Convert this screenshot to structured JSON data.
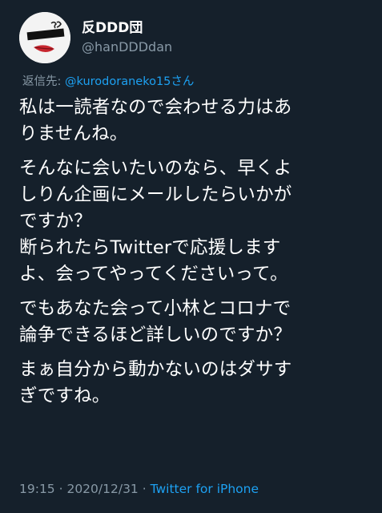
{
  "author": {
    "display_name": "反DDD団",
    "handle": "@hanDDDdan"
  },
  "reply": {
    "prefix": "返信先: ",
    "mention": "@kurodoraneko15さん"
  },
  "tweet": {
    "paragraphs": [
      [
        "私は一読者なので会わせる力はあ",
        "りませんね。"
      ],
      [
        "そんなに会いたいのなら、早くよ",
        "しりん企画にメールしたらいかが",
        "ですか？",
        "断られたらTwitterで応援します",
        "よ、会ってやってくださいって。"
      ],
      [
        "でもあなた会って小林とコロナで",
        "論争できるほど詳しいのですか？"
      ],
      [
        "まぁ自分から動かないのはダサす",
        "ぎですね。"
      ]
    ]
  },
  "meta": {
    "time": "19:15",
    "sep1": " · ",
    "date": "2020/12/31",
    "sep2": " · ",
    "source": "Twitter for iPhone"
  },
  "colors": {
    "background": "#15202b",
    "text": "#ffffff",
    "secondary": "#8899a6",
    "link": "#1da1f2"
  }
}
